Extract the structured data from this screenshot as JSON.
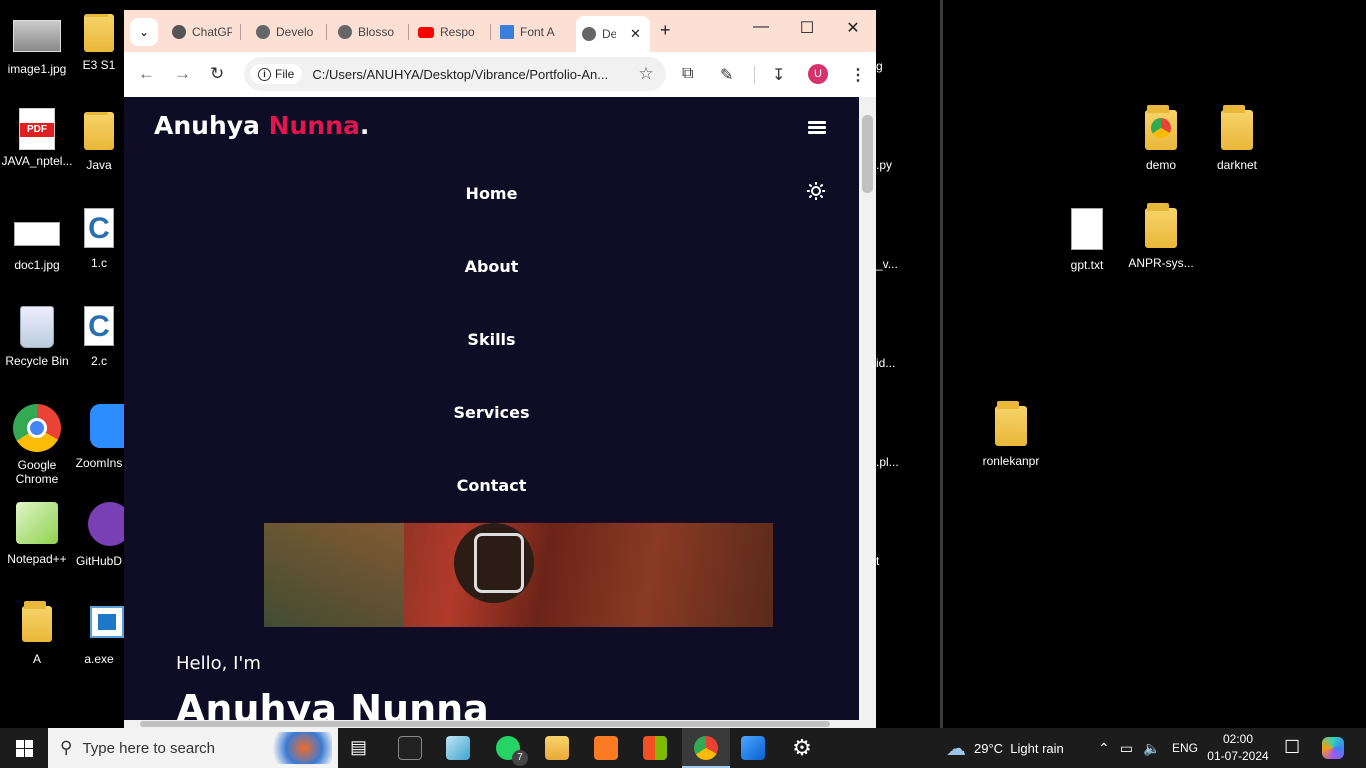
{
  "desktop": {
    "left_icons": [
      {
        "label": "image1.jpg",
        "icon": "image-file-icon"
      },
      {
        "label": "E3 S1",
        "icon": "folder-icon"
      },
      {
        "label": "JAVA_nptel...",
        "icon": "pdf-file-icon",
        "badge": "PDF"
      },
      {
        "label": "Java",
        "icon": "folder-icon"
      },
      {
        "label": "doc1.jpg",
        "icon": "image-file-icon"
      },
      {
        "label": "1.c",
        "icon": "c-file-icon"
      },
      {
        "label": "Recycle Bin",
        "icon": "recycle-bin-icon"
      },
      {
        "label": "2.c",
        "icon": "c-file-icon"
      },
      {
        "label": "Google Chrome",
        "icon": "chrome-icon"
      },
      {
        "label": "ZoomIns",
        "icon": "zoom-icon"
      },
      {
        "label": "Notepad++",
        "icon": "notepadpp-icon"
      },
      {
        "label": "GitHubD",
        "icon": "github-desktop-icon"
      },
      {
        "label": "A",
        "icon": "folder-icon"
      },
      {
        "label": "a.exe",
        "icon": "exe-file-icon"
      }
    ],
    "hidden_labels": [
      "g",
      ".py",
      "_v...",
      "id...",
      ".pl...",
      "t"
    ],
    "right_icons": [
      {
        "label": "demo",
        "icon": "folder-icon"
      },
      {
        "label": "darknet",
        "icon": "folder-icon"
      },
      {
        "label": "gpt.txt",
        "icon": "text-file-icon"
      },
      {
        "label": "ANPR-sys...",
        "icon": "folder-icon"
      },
      {
        "label": "ronlekanpr",
        "icon": "folder-icon"
      }
    ]
  },
  "browser": {
    "tabs": [
      {
        "label": "ChatGPT",
        "icon": "chatgpt-icon"
      },
      {
        "label": "Develo",
        "icon": "globe-icon"
      },
      {
        "label": "Blosso",
        "icon": "globe-icon"
      },
      {
        "label": "Respo",
        "icon": "youtube-icon"
      },
      {
        "label": "Font A",
        "icon": "flag-icon"
      },
      {
        "label": "De",
        "icon": "globe-icon",
        "active": true
      }
    ],
    "address_chip": "File",
    "url": "C:/Users/ANUHYA/Desktop/Vibrance/Portfolio-An...",
    "profile_initial": "U"
  },
  "page": {
    "logo_first": "Anuhya ",
    "logo_accent": "Nunna",
    "logo_dot": ".",
    "nav": [
      "Home",
      "About",
      "Skills",
      "Services",
      "Contact"
    ],
    "hello": "Hello, I'm",
    "name": "Anuhya Nunna",
    "accent_color": "#e0164f"
  },
  "taskbar": {
    "search_placeholder": "Type here to search",
    "whatsapp_badge": "7",
    "weather": "29°C  Light rain",
    "language": "ENG",
    "time": "02:00",
    "date": "01-07-2024"
  }
}
